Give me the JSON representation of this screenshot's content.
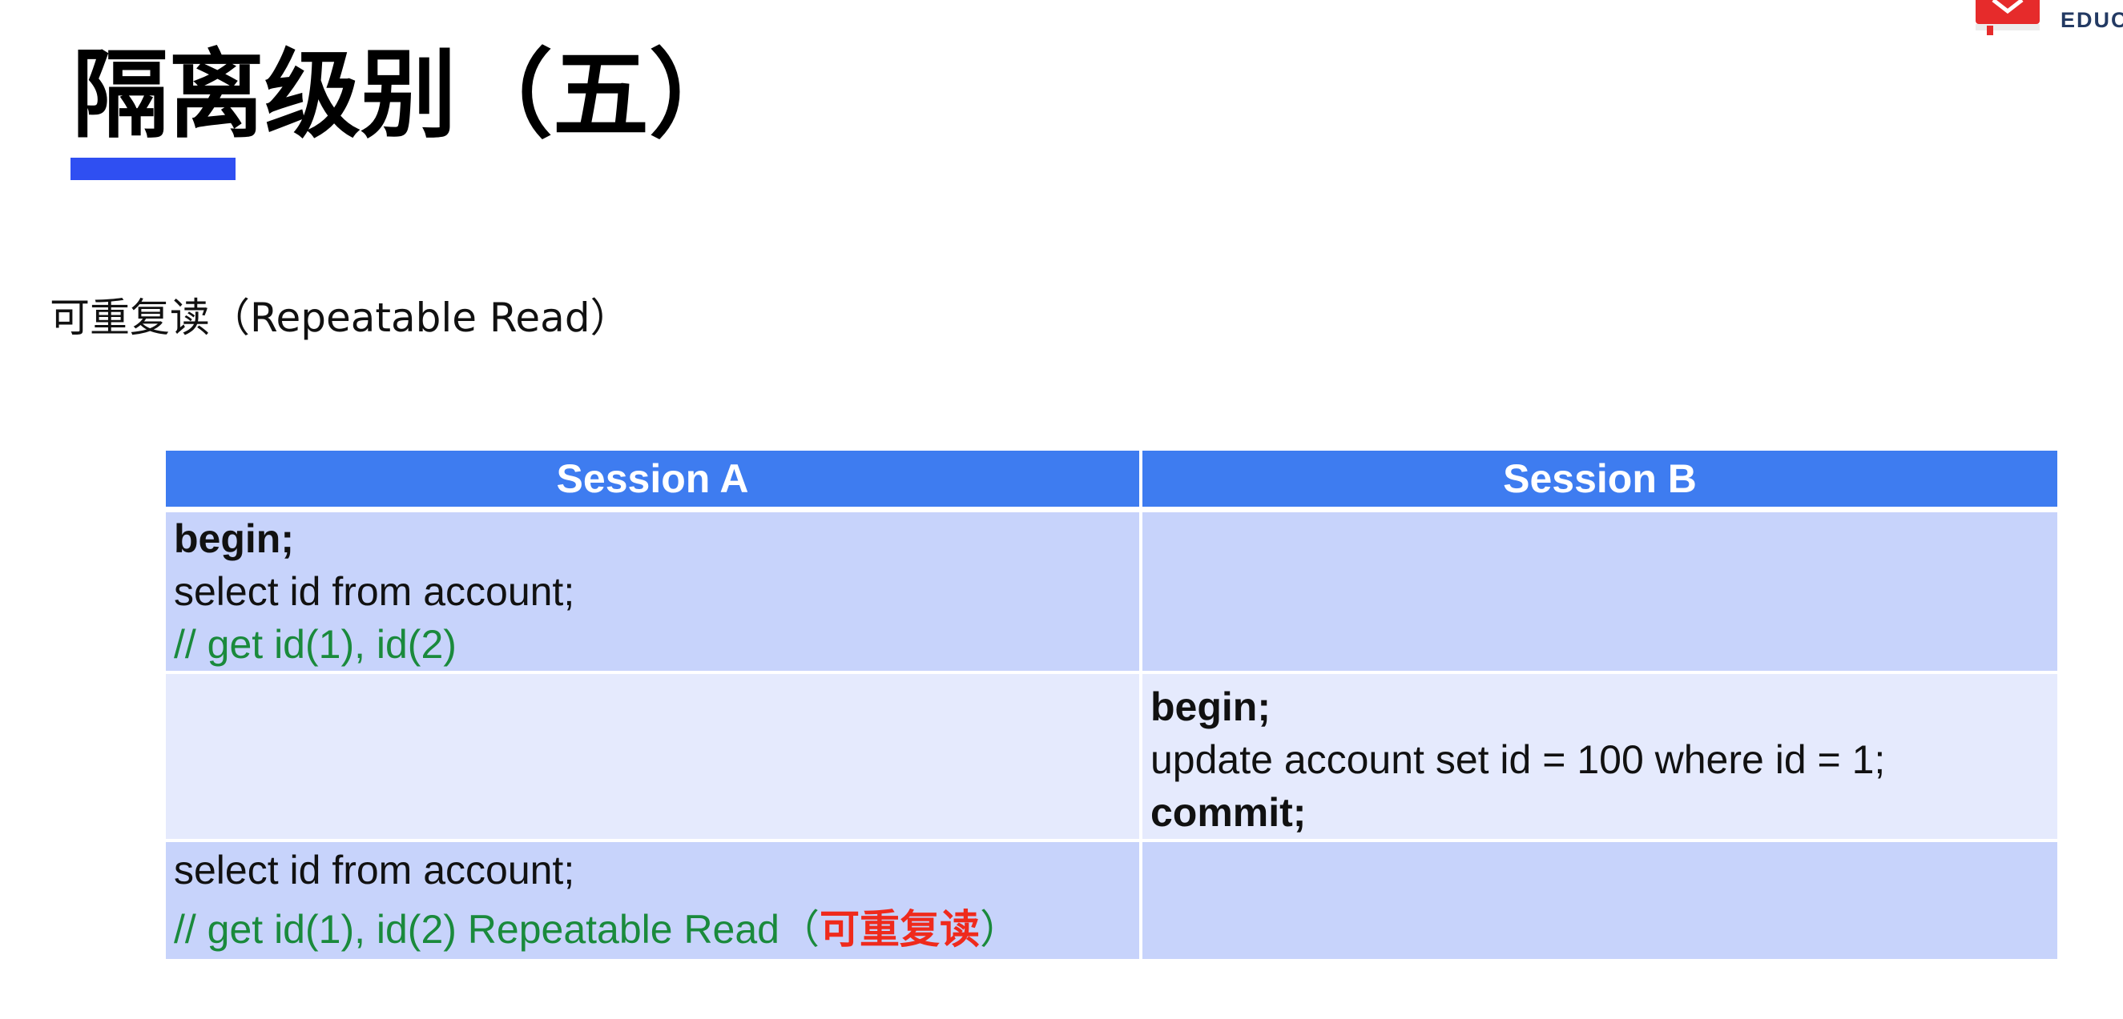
{
  "logo": {
    "text": "EDUC",
    "brand_color": "#e62b2b"
  },
  "title": "隔离级别（五）",
  "subtitle": "可重复读（Repeatable Read）",
  "colors": {
    "header_bg": "#3e7cf0",
    "row_dark": "#c7d3fb",
    "row_light": "#e5eafd",
    "comment": "#1a8a3c",
    "highlight": "#ef2a1c",
    "underline": "#2f4ff2"
  },
  "table": {
    "headers": [
      "Session A",
      "Session B"
    ],
    "rows": [
      {
        "session_a": {
          "line1": "begin;",
          "line2": "select id from account;",
          "line3": "// get id(1), id(2)"
        },
        "session_b": {}
      },
      {
        "session_a": {},
        "session_b": {
          "line1": "begin;",
          "line2": "update account set id = 100 where id = 1;",
          "line3": "commit;"
        }
      },
      {
        "session_a": {
          "line1": "select id from account;",
          "line2_comment": "// get id(1), id(2) Repeatable Read（",
          "line2_highlight": "可重复读",
          "line2_close": "）"
        },
        "session_b": {}
      }
    ]
  }
}
